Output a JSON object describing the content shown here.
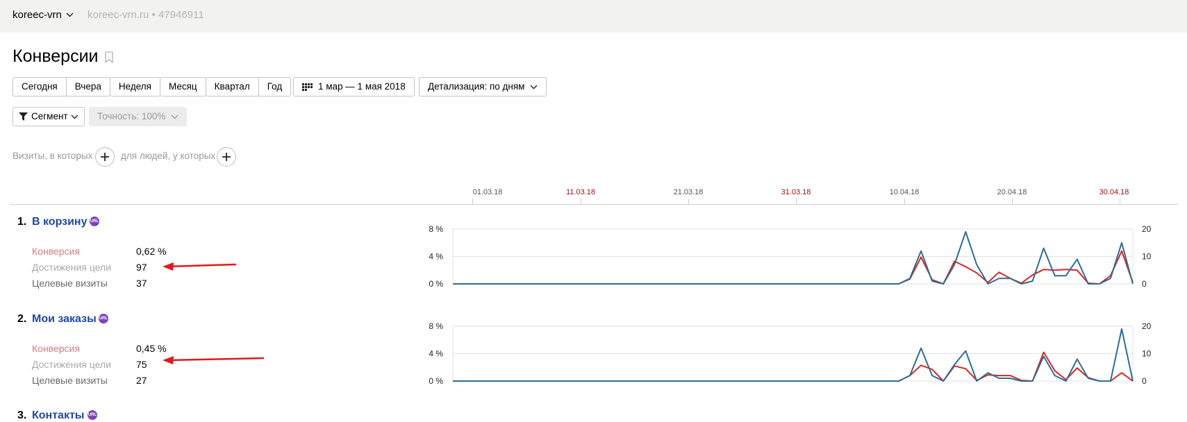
{
  "header": {
    "counter_name": "koreec-vrn",
    "counter_meta": "koreec-vrn.ru • 47946911"
  },
  "page": {
    "title": "Конверсии"
  },
  "period_buttons": [
    "Сегодня",
    "Вчера",
    "Неделя",
    "Месяц",
    "Квартал",
    "Год"
  ],
  "date_range": "1 мар — 1 мая 2018",
  "detail": "Детализация: по дням",
  "segment": "Сегмент",
  "accuracy": "Точность: 100%",
  "filters": {
    "visits_label": "Визиты, в которых",
    "people_label": "для людей, у которых"
  },
  "timeline_ticks": [
    {
      "label": "01.03.18",
      "weekend": false
    },
    {
      "label": "11.03.18",
      "weekend": true
    },
    {
      "label": "21.03.18",
      "weekend": false
    },
    {
      "label": "31.03.18",
      "weekend": true
    },
    {
      "label": "10.04.18",
      "weekend": false
    },
    {
      "label": "20.04.18",
      "weekend": false
    },
    {
      "label": "30.04.18",
      "weekend": true
    }
  ],
  "goals": [
    {
      "num": "1.",
      "name": "В корзину",
      "badge": "URL",
      "metrics": [
        {
          "label": "Конверсия",
          "value": "0,62 %"
        },
        {
          "label": "Достижения цели",
          "value": "97"
        },
        {
          "label": "Целевые визиты",
          "value": "37"
        }
      ]
    },
    {
      "num": "2.",
      "name": "Мои заказы",
      "badge": "URL",
      "metrics": [
        {
          "label": "Конверсия",
          "value": "0,45 %"
        },
        {
          "label": "Достижения цели",
          "value": "75"
        },
        {
          "label": "Целевые визиты",
          "value": "27"
        }
      ]
    },
    {
      "num": "3.",
      "name": "Контакты",
      "badge": "URL"
    }
  ],
  "colors": {
    "link": "#1e49a6",
    "conversion_line": "#d62728",
    "reaches_line": "#2f6b95",
    "annotation_arrow": "#e0191b",
    "url_badge": "#7e45b4"
  },
  "chart_data": [
    {
      "type": "line",
      "x": [
        "01.03.18",
        "02.03.18",
        "03.03.18",
        "04.03.18",
        "05.03.18",
        "06.03.18",
        "07.03.18",
        "08.03.18",
        "09.03.18",
        "10.03.18",
        "11.03.18",
        "12.03.18",
        "13.03.18",
        "14.03.18",
        "15.03.18",
        "16.03.18",
        "17.03.18",
        "18.03.18",
        "19.03.18",
        "20.03.18",
        "21.03.18",
        "22.03.18",
        "23.03.18",
        "24.03.18",
        "25.03.18",
        "26.03.18",
        "27.03.18",
        "28.03.18",
        "29.03.18",
        "30.03.18",
        "31.03.18",
        "01.04.18",
        "02.04.18",
        "03.04.18",
        "04.04.18",
        "05.04.18",
        "06.04.18",
        "07.04.18",
        "08.04.18",
        "09.04.18",
        "10.04.18",
        "11.04.18",
        "12.04.18",
        "13.04.18",
        "14.04.18",
        "15.04.18",
        "16.04.18",
        "17.04.18",
        "18.04.18",
        "19.04.18",
        "20.04.18",
        "21.04.18",
        "22.04.18",
        "23.04.18",
        "24.04.18",
        "25.04.18",
        "26.04.18",
        "27.04.18",
        "28.04.18",
        "29.04.18",
        "30.04.18",
        "01.05.18"
      ],
      "y_left_ticks": [
        "0 %",
        "4 %",
        "8 %"
      ],
      "y_right_ticks": [
        "0",
        "10",
        "20"
      ],
      "ylim_left": [
        0,
        8
      ],
      "ylim_right": [
        0,
        20
      ],
      "series": [
        {
          "axis": "left",
          "values": [
            0,
            0,
            0,
            0,
            0,
            0,
            0,
            0,
            0,
            0,
            0,
            0,
            0,
            0,
            0,
            0,
            0,
            0,
            0,
            0,
            0,
            0,
            0,
            0,
            0,
            0,
            0,
            0,
            0,
            0,
            0,
            0,
            0,
            0,
            0,
            0,
            0,
            0,
            0,
            0,
            0,
            0.7,
            3.9,
            0.6,
            0,
            3.3,
            2.5,
            1.6,
            0.2,
            1.7,
            0.8,
            0.1,
            1.3,
            2.1,
            2.0,
            2.1,
            2.0,
            0.1,
            0,
            1.2,
            4.8,
            0.2
          ]
        },
        {
          "axis": "right",
          "values": [
            0,
            0,
            0,
            0,
            0,
            0,
            0,
            0,
            0,
            0,
            0,
            0,
            0,
            0,
            0,
            0,
            0,
            0,
            0,
            0,
            0,
            0,
            0,
            0,
            0,
            0,
            0,
            0,
            0,
            0,
            0,
            0,
            0,
            0,
            0,
            0,
            0,
            0,
            0,
            0,
            0,
            2,
            12,
            1,
            0,
            7,
            19,
            7,
            0,
            2,
            2,
            0,
            1,
            13,
            3,
            3,
            9,
            0,
            0,
            2,
            15,
            0
          ]
        }
      ]
    },
    {
      "type": "line",
      "x": [
        "01.03.18",
        "02.03.18",
        "03.03.18",
        "04.03.18",
        "05.03.18",
        "06.03.18",
        "07.03.18",
        "08.03.18",
        "09.03.18",
        "10.03.18",
        "11.03.18",
        "12.03.18",
        "13.03.18",
        "14.03.18",
        "15.03.18",
        "16.03.18",
        "17.03.18",
        "18.03.18",
        "19.03.18",
        "20.03.18",
        "21.03.18",
        "22.03.18",
        "23.03.18",
        "24.03.18",
        "25.03.18",
        "26.03.18",
        "27.03.18",
        "28.03.18",
        "29.03.18",
        "30.03.18",
        "31.03.18",
        "01.04.18",
        "02.04.18",
        "03.04.18",
        "04.04.18",
        "05.04.18",
        "06.04.18",
        "07.04.18",
        "08.04.18",
        "09.04.18",
        "10.04.18",
        "11.04.18",
        "12.04.18",
        "13.04.18",
        "14.04.18",
        "15.04.18",
        "16.04.18",
        "17.04.18",
        "18.04.18",
        "19.04.18",
        "20.04.18",
        "21.04.18",
        "22.04.18",
        "23.04.18",
        "24.04.18",
        "25.04.18",
        "26.04.18",
        "27.04.18",
        "28.04.18",
        "29.04.18",
        "30.04.18",
        "01.05.18"
      ],
      "y_left_ticks": [
        "0 %",
        "4 %",
        "8 %"
      ],
      "y_right_ticks": [
        "0",
        "10",
        "20"
      ],
      "ylim_left": [
        0,
        8
      ],
      "ylim_right": [
        0,
        20
      ],
      "series": [
        {
          "axis": "left",
          "values": [
            0,
            0,
            0,
            0,
            0,
            0,
            0,
            0,
            0,
            0,
            0,
            0,
            0,
            0,
            0,
            0,
            0,
            0,
            0,
            0,
            0,
            0,
            0,
            0,
            0,
            0,
            0,
            0,
            0,
            0,
            0,
            0,
            0,
            0,
            0,
            0,
            0,
            0,
            0,
            0,
            0,
            0.8,
            2.3,
            1.7,
            0,
            2.2,
            1.8,
            0.1,
            0.9,
            0.8,
            0.8,
            0.1,
            0,
            4.2,
            1.5,
            0.2,
            1.9,
            0.5,
            0,
            0,
            1.2,
            0
          ]
        },
        {
          "axis": "right",
          "values": [
            0,
            0,
            0,
            0,
            0,
            0,
            0,
            0,
            0,
            0,
            0,
            0,
            0,
            0,
            0,
            0,
            0,
            0,
            0,
            0,
            0,
            0,
            0,
            0,
            0,
            0,
            0,
            0,
            0,
            0,
            0,
            0,
            0,
            0,
            0,
            0,
            0,
            0,
            0,
            0,
            0,
            2,
            12,
            2,
            0,
            6,
            11,
            0,
            3,
            1,
            1,
            0,
            0,
            9,
            2,
            0,
            8,
            1,
            0,
            0,
            19,
            0
          ]
        }
      ]
    }
  ]
}
